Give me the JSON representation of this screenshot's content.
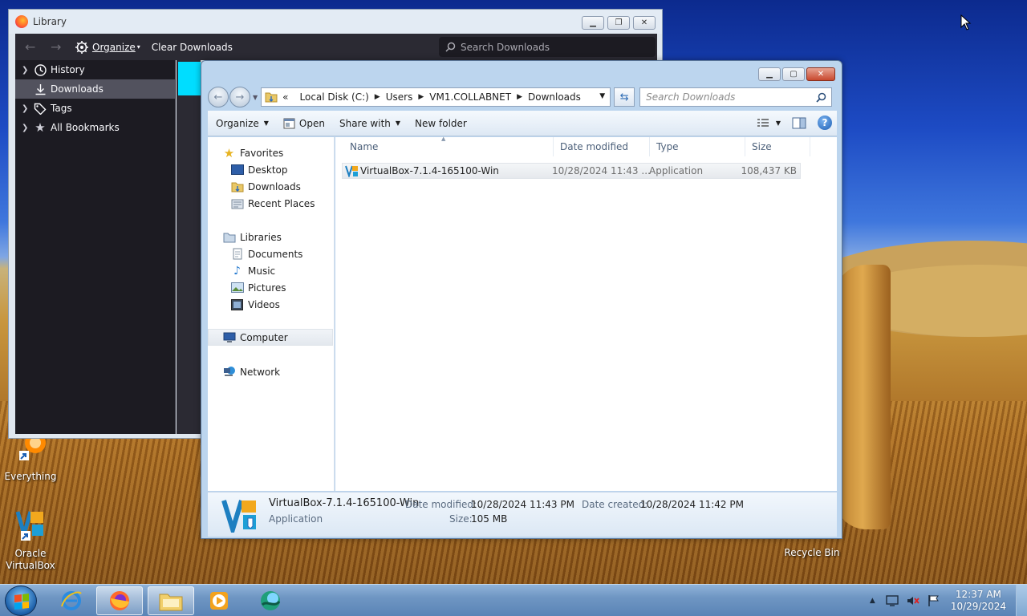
{
  "library": {
    "title": "Library",
    "organize_label": "Organize",
    "clear_label": "Clear Downloads",
    "search_placeholder": "Search Downloads",
    "tree": [
      {
        "label": "History",
        "icon": "clock-icon"
      },
      {
        "label": "Downloads",
        "icon": "download-icon",
        "selected": true
      },
      {
        "label": "Tags",
        "icon": "tag-icon"
      },
      {
        "label": "All Bookmarks",
        "icon": "star-icon"
      }
    ]
  },
  "explorer": {
    "breadcrumb": {
      "overflow": "«",
      "items": [
        "Local Disk (C:)",
        "Users",
        "VM1.COLLABNET",
        "Downloads"
      ]
    },
    "search_placeholder": "Search Downloads",
    "commands": {
      "organize": "Organize",
      "open": "Open",
      "share": "Share with",
      "new_folder": "New folder"
    },
    "nav": {
      "favorites": "Favorites",
      "desktop": "Desktop",
      "downloads": "Downloads",
      "recent": "Recent Places",
      "libraries": "Libraries",
      "documents": "Documents",
      "music": "Music",
      "pictures": "Pictures",
      "videos": "Videos",
      "computer": "Computer",
      "network": "Network"
    },
    "columns": {
      "name": "Name",
      "date": "Date modified",
      "type": "Type",
      "size": "Size"
    },
    "files": [
      {
        "name": "VirtualBox-7.1.4-165100-Win",
        "date": "10/28/2024 11:43 ...",
        "type": "Application",
        "size": "108,437 KB"
      }
    ],
    "details": {
      "name": "VirtualBox-7.1.4-165100-Win",
      "type": "Application",
      "modified_label": "Date modified:",
      "modified_value": "10/28/2024 11:43 PM",
      "created_label": "Date created:",
      "created_value": "10/28/2024 11:42 PM",
      "size_label": "Size:",
      "size_value": "105 MB"
    }
  },
  "desktop_icons": {
    "everything": "Everything",
    "virtualbox": "Oracle VirtualBox",
    "recycle": "Recycle Bin"
  },
  "taskbar": {
    "time": "12:37 AM",
    "date": "10/29/2024"
  },
  "colors": {
    "firefox_dark": "#1c1b22",
    "explorer_frame": "#bcd5ee",
    "taskbar": "#6f96c3"
  }
}
